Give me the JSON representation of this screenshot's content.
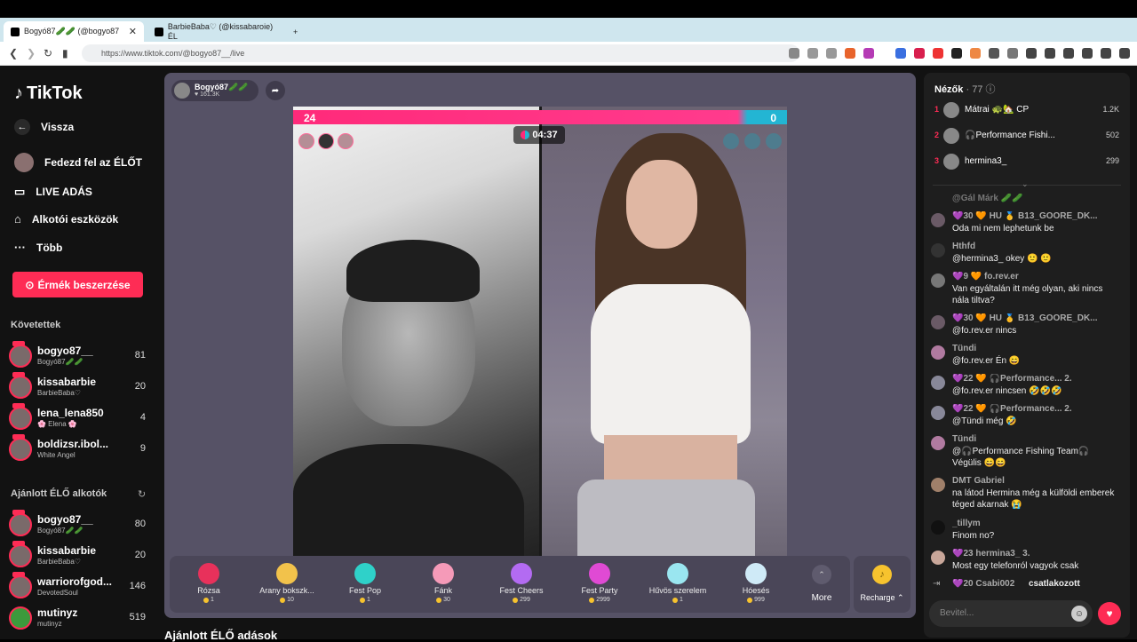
{
  "browser": {
    "tabs": [
      {
        "title": "Bogyó87🥒🥒 (@bogyo87",
        "close": "✕"
      },
      {
        "title": "BarbieBaba♡ (@kissabaroie) ÉL",
        "close": ""
      }
    ],
    "new_tab": "+",
    "url": "https://www.tiktok.com/@bogyo87__/live"
  },
  "sidebar": {
    "logo": "TikTok",
    "nav": [
      {
        "label": "Vissza",
        "icon": "back-arrow-icon"
      },
      {
        "label": "Fedezd fel az ÉLŐT",
        "icon": "avatar-icon"
      },
      {
        "label": "LIVE ADÁS",
        "icon": "video-camera-icon"
      },
      {
        "label": "Alkotói eszközök",
        "icon": "lightbulb-icon"
      },
      {
        "label": "Több",
        "icon": "more-dots-icon"
      }
    ],
    "coins_button": "Érmék beszerzése",
    "following_title": "Követettek",
    "following": [
      {
        "name": "bogyo87__",
        "sub": "Bogyó87🥒🥒",
        "count": "81"
      },
      {
        "name": "kissabarbie",
        "sub": "BarbieBaba♡",
        "count": "20"
      },
      {
        "name": "lena_lena850",
        "sub": "🌸 Elena 🌸",
        "count": "4"
      },
      {
        "name": "boldizsr.ibol...",
        "sub": "White Angel",
        "count": "9"
      }
    ],
    "recommended_title": "Ajánlott ÉLŐ alkotók",
    "recommended": [
      {
        "name": "bogyo87__",
        "sub": "Bogyó87🥒🥒",
        "count": "80"
      },
      {
        "name": "kissabarbie",
        "sub": "BarbieBaba♡",
        "count": "20"
      },
      {
        "name": "warriorofgod...",
        "sub": "DevotedSoul",
        "count": "146"
      },
      {
        "name": "mutinyz",
        "sub": "mutinyz",
        "count": "519"
      }
    ]
  },
  "live": {
    "host_name": "Bogyó87🥒🥒",
    "host_likes": "♥ 161.3K",
    "pk_left": "24",
    "pk_right": "0",
    "timer": "04:37",
    "gifts": [
      {
        "name": "Rózsa",
        "price": "1",
        "color": "#e8315b"
      },
      {
        "name": "Arany bokszk...",
        "price": "10",
        "color": "#f2c24b"
      },
      {
        "name": "Fest Pop",
        "price": "1",
        "color": "#2fd1c9"
      },
      {
        "name": "Fánk",
        "price": "30",
        "color": "#f59ab8"
      },
      {
        "name": "Fest Cheers",
        "price": "299",
        "color": "#b36bf2"
      },
      {
        "name": "Fest Party",
        "price": "2999",
        "color": "#e04ad4"
      },
      {
        "name": "Hűvös szerelem",
        "price": "1",
        "color": "#9ae6f0"
      },
      {
        "name": "Hóesés",
        "price": "999",
        "color": "#cfeaf7"
      }
    ],
    "more_label": "More",
    "recharge_label": "Recharge ⌃"
  },
  "recommended_live_title": "Ajánlott ÉLŐ adások",
  "chat": {
    "viewers_label": "Nézők",
    "viewers_count": "· 77",
    "top_viewers": [
      {
        "rank": "1",
        "name": "Mátrai 🐢🏡 CP",
        "score": "1.2K"
      },
      {
        "rank": "2",
        "name": "🎧Performance Fishi...",
        "score": "502"
      },
      {
        "rank": "3",
        "name": "hermina3_",
        "score": "299"
      }
    ],
    "messages": [
      {
        "user": "@Gál Márk 🥒🥒",
        "text": ""
      },
      {
        "user": "💜30 🧡 HU 🥇 B13_GOORE_DK...",
        "text": "Oda mi nem lephetunk be"
      },
      {
        "user": "Hthfd",
        "text": "@hermina3_ okey 🙂 🙂"
      },
      {
        "user": "💜9 🧡 fo.rev.er",
        "text": "Van egyáltalán itt még olyan, aki nincs nála tiltva?"
      },
      {
        "user": "💜30 🧡 HU 🥇 B13_GOORE_DK...",
        "text": "@fo.rev.er nincs"
      },
      {
        "user": "Tündi",
        "text": "@fo.rev.er Én 😄"
      },
      {
        "user": "💜22 🧡 🎧Performance... 2.",
        "text": "@fo.rev.er nincsen 🤣🤣🤣"
      },
      {
        "user": "💜22 🧡 🎧Performance... 2.",
        "text": "@Tündi még 🤣"
      },
      {
        "user": "Tündi",
        "text": "@🎧Performance Fishing Team🎧 Végülis 😄😄"
      },
      {
        "user": "DMT Gabriel",
        "text": "na látod Hermina még a külföldi emberek téged akarnak 😭"
      },
      {
        "user": "_tillym",
        "text": "Finom no?"
      },
      {
        "user": "💜23 hermina3_ 3.",
        "text": "Most egy telefonról vagyok csak"
      },
      {
        "user": "💜20 Csabi002",
        "text": "csatlakozott"
      }
    ],
    "input_placeholder": "Bevitel..."
  }
}
